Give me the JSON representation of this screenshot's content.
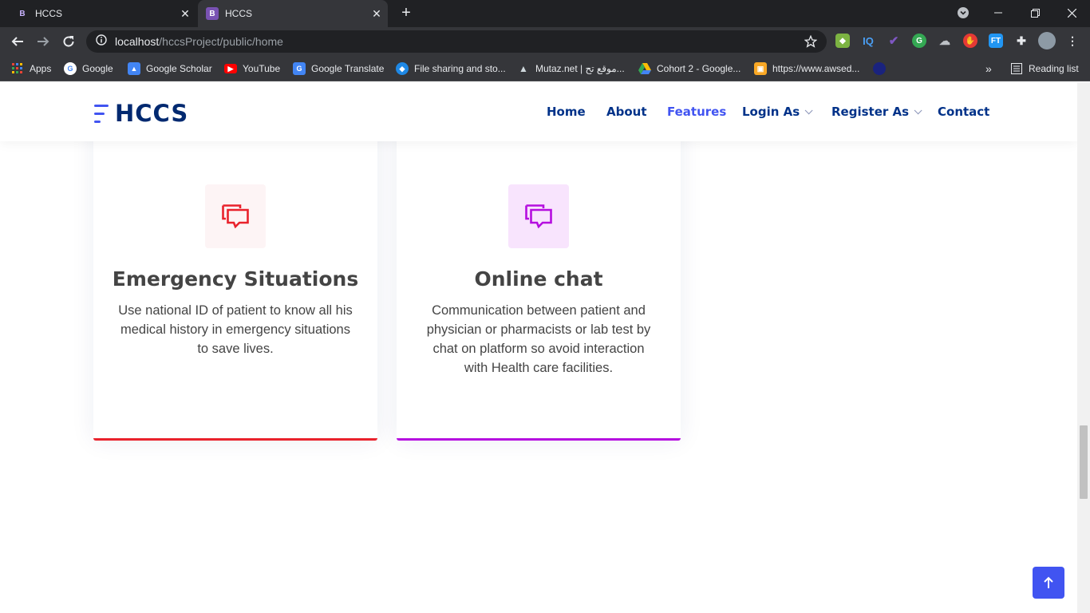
{
  "browser": {
    "tabs": [
      {
        "favicon": "B",
        "title": "HCCS"
      },
      {
        "favicon": "B",
        "title": "HCCS"
      }
    ],
    "address": {
      "host": "localhost",
      "path": "/hccsProject/public/home"
    },
    "bookmarks": [
      {
        "label": "Apps",
        "icon": "apps-grid-icon"
      },
      {
        "label": "Google",
        "icon": "google-icon"
      },
      {
        "label": "Google Scholar",
        "icon": "scholar-icon"
      },
      {
        "label": "YouTube",
        "icon": "youtube-icon"
      },
      {
        "label": "Google Translate",
        "icon": "translate-icon"
      },
      {
        "label": "File sharing and sto...",
        "icon": "file-sharing-icon"
      },
      {
        "label": "Mutaz.net | موقع تح...",
        "icon": "mutaz-icon"
      },
      {
        "label": "Cohort 2 - Google...",
        "icon": "drive-icon"
      },
      {
        "label": "https://www.awsed...",
        "icon": "box-icon"
      }
    ],
    "reading_list": "Reading list",
    "more": "»"
  },
  "site": {
    "logo_text": "HCCS",
    "nav": [
      {
        "label": "Home"
      },
      {
        "label": "About"
      },
      {
        "label": "Features"
      },
      {
        "label": "Login As"
      },
      {
        "label": "Register As"
      },
      {
        "label": "Contact"
      }
    ]
  },
  "features": [
    {
      "title": "Emergency Situations",
      "description": "Use national ID of patient to know all his medical history in emergency situations to save lives.",
      "accent": "#e9222c",
      "icon_bg": "#fdf4f5",
      "icon": "chat-bubbles-icon"
    },
    {
      "title": "Online chat",
      "description": "Communication between patient and physician or pharmacists or lab test by chat on platform so avoid interaction with Health care facilities.",
      "accent": "#b50edf",
      "icon_bg": "#f8e4fd",
      "icon": "chat-bubbles-icon"
    }
  ],
  "colors": {
    "primary": "#4154f1",
    "nav_text": "#013289",
    "logo": "#012970"
  }
}
